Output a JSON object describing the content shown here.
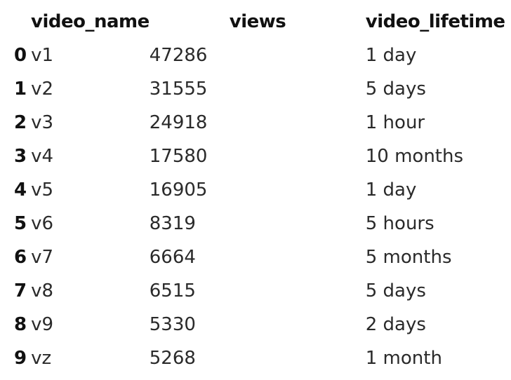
{
  "table": {
    "columns": [
      "video_name",
      "views",
      "video_lifetime"
    ],
    "rows": [
      {
        "index": "0",
        "video_name": "v1",
        "views": "47286",
        "video_lifetime": "1 day"
      },
      {
        "index": "1",
        "video_name": "v2",
        "views": "31555",
        "video_lifetime": "5 days"
      },
      {
        "index": "2",
        "video_name": "v3",
        "views": "24918",
        "video_lifetime": "1 hour"
      },
      {
        "index": "3",
        "video_name": "v4",
        "views": "17580",
        "video_lifetime": "10 months"
      },
      {
        "index": "4",
        "video_name": "v5",
        "views": "16905",
        "video_lifetime": "1 day"
      },
      {
        "index": "5",
        "video_name": "v6",
        "views": "8319",
        "video_lifetime": "5 hours"
      },
      {
        "index": "6",
        "video_name": "v7",
        "views": "6664",
        "video_lifetime": "5 months"
      },
      {
        "index": "7",
        "video_name": "v8",
        "views": "6515",
        "video_lifetime": "5 days"
      },
      {
        "index": "8",
        "video_name": "v9",
        "views": "5330",
        "video_lifetime": "2 days"
      },
      {
        "index": "9",
        "video_name": "vz",
        "views": "5268",
        "video_lifetime": "1 month"
      }
    ]
  }
}
